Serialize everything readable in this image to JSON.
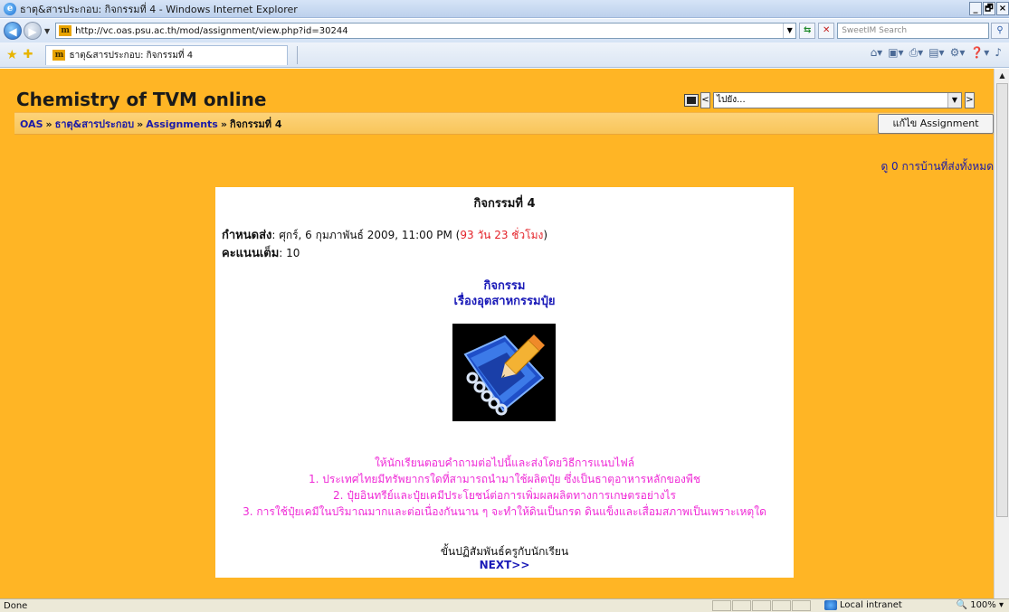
{
  "window": {
    "title": "ธาตุ&สารประกอบ: กิจกรรมที่ 4 - Windows Internet Explorer",
    "buttons": [
      "_",
      "🗗",
      "×"
    ]
  },
  "address_bar": {
    "url": "http://vc.oas.psu.ac.th/mod/assignment/view.php?id=30244",
    "search_placeholder": "SweetIM Search",
    "ie_logo": "e",
    "back_glyph": "◀",
    "fwd_glyph": "▶",
    "refresh_glyph": "⇆",
    "stop_glyph": "✕",
    "search_go_glyph": "⚲"
  },
  "tab": {
    "label": "ธาตุ&สารประกอบ: กิจกรรมที่ 4",
    "favicon": "m"
  },
  "page": {
    "site_title": "Chemistry of TVM online",
    "jump": {
      "placeholder": "ไปยัง...",
      "prev": "<",
      "next": ">"
    },
    "breadcrumb": {
      "home": "OAS",
      "course": "ธาตุ&สารประกอบ",
      "section": "Assignments",
      "current": "กิจกรรมที่ 4",
      "separator": "»"
    },
    "edit_button": "แก้ไข Assignment",
    "view_all": "ดู 0 การบ้านที่ส่งทั้งหมด",
    "assignment": {
      "title": "กิจกรรมที่ 4",
      "due_label": "กำหนดส่ง",
      "due_value": ": ศุกร์, 6 กุมภาพันธ์ 2009, 11:00 PM (",
      "remaining": "93 วัน 23 ชั่วโมง",
      "due_close": ")",
      "grade_label": "คะแนนเต็ม",
      "grade_value": ": 10",
      "activity_line1": "กิจกรรม",
      "activity_line2": "เรื่องอุตสาหกรรมปุ๋ย",
      "questions": [
        "ให้นักเรียนตอบคำถามต่อไปนี้และส่งโดยวิธีการแนบไฟล์",
        "1. ประเทศไทยมีทรัพยากรใดที่สามารถนำมาใช้ผลิตปุ๋ย ซึ่งเป็นธาตุอาหารหลักของพืช",
        "2. ปุ๋ยอินทรีย์และปุ๋ยเคมีประโยชน์ต่อการเพิ่มผลผลิตทางการเกษตรอย่างไร",
        "3. การใช้ปุ๋ยเคมีในปริมาณมากและต่อเนื่องกันนาน ๆ จะทำให้ดินเป็นกรด ดินแข็งและเสื่อมสภาพเป็นเพราะเหตุใด"
      ],
      "reference": "ขั้นปฏิสัมพันธ์ครูกับนักเรียน",
      "next_link": "NEXT>>"
    }
  },
  "status": {
    "text": "Done",
    "zone": "Local intranet",
    "zoom": "100%"
  },
  "colors": {
    "page_background": "#ffb525",
    "link": "#1a1ab8",
    "question_text": "#ef2ad6",
    "due_remaining": "#e4232a"
  }
}
